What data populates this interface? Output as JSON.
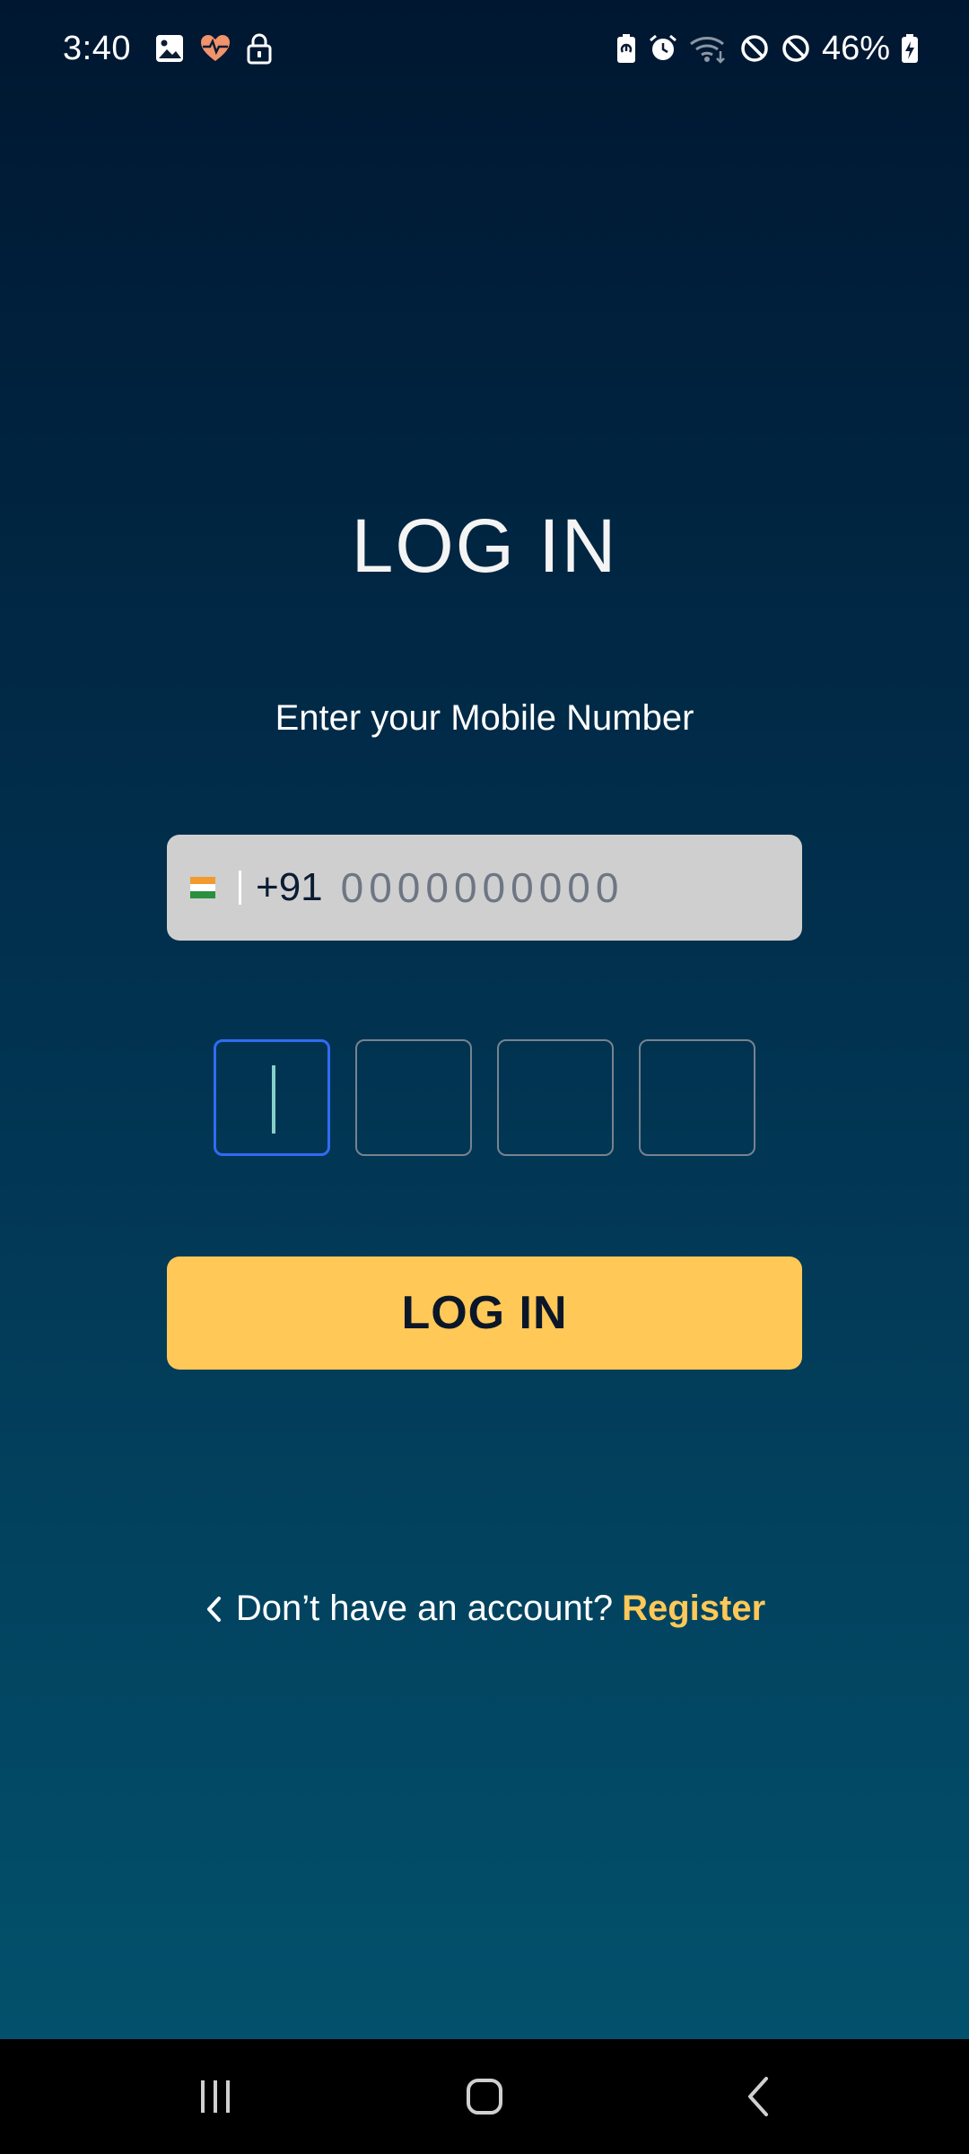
{
  "status_bar": {
    "time": "3:40",
    "battery_percent": "46%",
    "left_icons": [
      "gallery-icon",
      "health-heart-icon",
      "lock-icon"
    ],
    "right_icons": [
      "battery-saver-icon",
      "alarm-icon",
      "wifi-icon",
      "do-not-disturb-icon",
      "do-not-disturb-icon",
      "battery-charging-icon"
    ]
  },
  "login": {
    "title": "LOG IN",
    "subtitle": "Enter your Mobile Number",
    "phone": {
      "country_code": "+91",
      "value": "",
      "placeholder": "0000000000",
      "flag": "india-flag"
    },
    "otp": {
      "digits": [
        "",
        "",
        "",
        ""
      ],
      "active_index": 0
    },
    "button_label": "LOG IN",
    "register_prompt": "Don’t have an account?",
    "register_link": "Register"
  },
  "colors": {
    "accent_yellow": "#ffc857",
    "background_top": "#001731",
    "background_bottom": "#03546f",
    "otp_active_border": "#2f6cf3",
    "field_background": "#cfcfcf"
  },
  "nav_bar": {
    "buttons": [
      "recents-icon",
      "home-icon",
      "back-icon"
    ]
  }
}
